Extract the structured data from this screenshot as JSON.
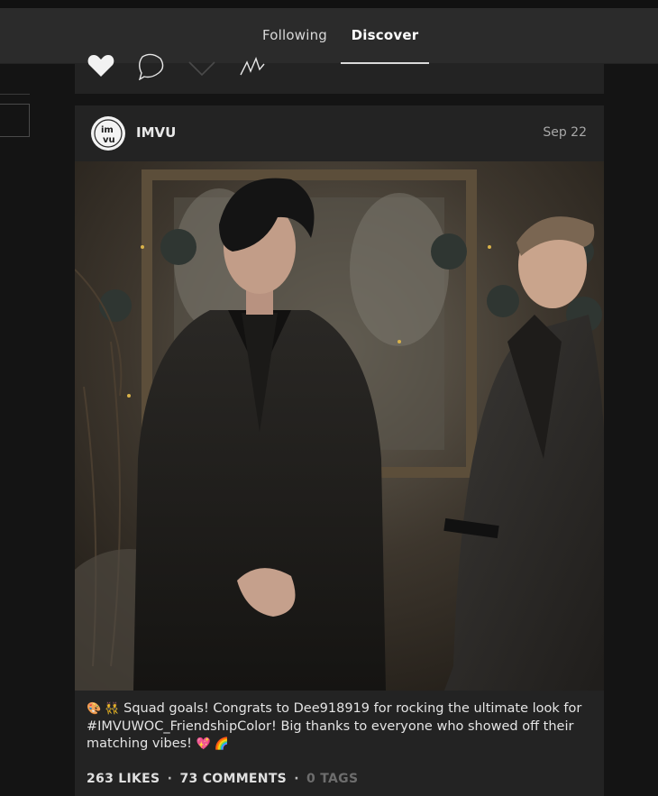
{
  "tabs": {
    "following": "Following",
    "discover": "Discover",
    "active": "Discover"
  },
  "prev_post": {
    "actions": [
      "heart-icon",
      "comment-icon",
      "share-icon",
      "stats-icon"
    ]
  },
  "post": {
    "author": "IMVU",
    "date": "Sep 22",
    "avatar_text": "imvu",
    "caption": {
      "emoji_start": "🎨 👯",
      "text": " Squad goals! Congrats to Dee918919 for rocking the ultimate look for #IMVUWOC_FriendshipColor! Big thanks to everyone who showed off their matching vibes! ",
      "emoji_end": "💖 🌈"
    },
    "likes": "263 LIKES",
    "comments": "73 COMMENTS",
    "tags": "0 TAGS",
    "separator": "·"
  },
  "colors": {
    "background": "#141414",
    "tabbar": "#2b2b2b",
    "card": "#232323",
    "text": "#e6e6e6",
    "muted": "#6d6d6d"
  }
}
